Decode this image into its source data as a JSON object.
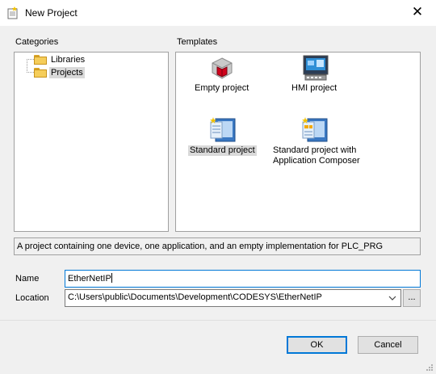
{
  "window": {
    "title": "New Project",
    "close_glyph": "✕"
  },
  "categories": {
    "label": "Categories",
    "items": [
      {
        "label": "Libraries",
        "selected": false
      },
      {
        "label": "Projects",
        "selected": true
      }
    ]
  },
  "templates": {
    "label": "Templates",
    "items": [
      {
        "label": "Empty project",
        "icon": "empty-project-icon",
        "selected": false
      },
      {
        "label": "HMI project",
        "icon": "hmi-project-icon",
        "selected": false
      },
      {
        "label": "Standard project",
        "icon": "standard-project-icon",
        "selected": true
      },
      {
        "label_line1": "Standard project with",
        "label_line2": "Application Composer",
        "icon": "application-composer-icon",
        "selected": false
      }
    ]
  },
  "description": "A project containing one device, one application, and an empty implementation for PLC_PRG",
  "name_field": {
    "label": "Name",
    "value": "EtherNetIP"
  },
  "location_field": {
    "label": "Location",
    "value": "C:\\Users\\public\\Documents\\Development\\CODESYS\\EtherNetIP",
    "browse_label": "..."
  },
  "buttons": {
    "ok": "OK",
    "cancel": "Cancel"
  },
  "colors": {
    "accent": "#0078d7",
    "selection": "#d9d9d9"
  }
}
